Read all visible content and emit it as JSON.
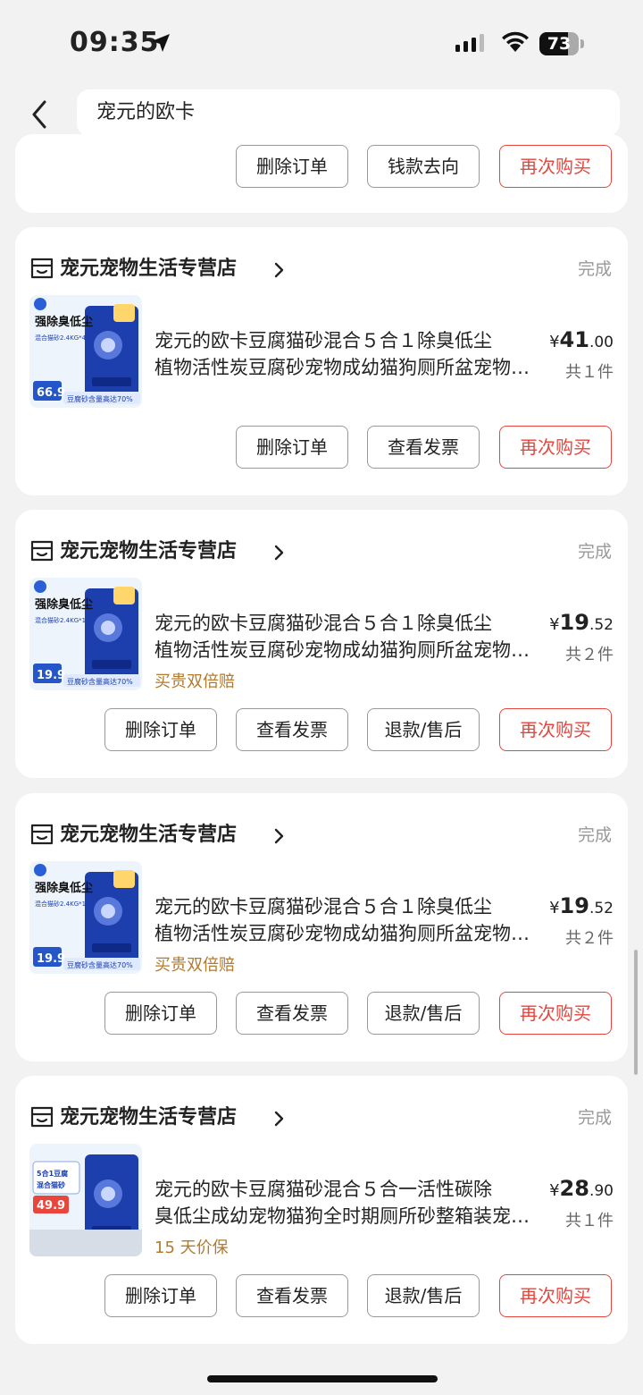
{
  "status_bar": {
    "time": "09:35",
    "battery": "73",
    "battery_level": 0.73
  },
  "header": {
    "search_text": "宠元的欧卡"
  },
  "top_card": {
    "buttons": [
      "删除订单",
      "钱款去向",
      "再次购买"
    ]
  },
  "orders": [
    {
      "shop": "宠元宠物生活专营店",
      "status": "完成",
      "title_line1": "宠元的欧卡豆腐猫砂混合５合１除臭低尘",
      "title_line2": "植物活性炭豆腐砂宠物成幼猫狗厕所盆宠物清洁用品",
      "price_int": "41",
      "price_dec": ".00",
      "currency": "¥",
      "qty": "共１件",
      "tag": "",
      "thumb": {
        "headline": "强除臭低尘",
        "spec": "混合猫砂2.4KG*4袋",
        "price": "66.9",
        "bottom": "豆腐砂含量高达70%"
      },
      "buttons": [
        "删除订单",
        "查看发票",
        "再次购买"
      ]
    },
    {
      "shop": "宠元宠物生活专营店",
      "status": "完成",
      "title_line1": "宠元的欧卡豆腐猫砂混合５合１除臭低尘",
      "title_line2": "植物活性炭豆腐砂宠物成幼猫狗厕所盆宠物清洁用品",
      "price_int": "19",
      "price_dec": ".52",
      "currency": "¥",
      "qty": "共２件",
      "tag": "买贵双倍赔",
      "thumb": {
        "headline": "强除臭低尘",
        "spec": "混合猫砂2.4KG*1袋",
        "price": "19.9",
        "bottom": "豆腐砂含量高达70%"
      },
      "buttons": [
        "删除订单",
        "查看发票",
        "退款/售后",
        "再次购买"
      ]
    },
    {
      "shop": "宠元宠物生活专营店",
      "status": "完成",
      "title_line1": "宠元的欧卡豆腐猫砂混合５合１除臭低尘",
      "title_line2": "植物活性炭豆腐砂宠物成幼猫狗厕所盆宠物清洁用品",
      "price_int": "19",
      "price_dec": ".52",
      "currency": "¥",
      "qty": "共２件",
      "tag": "买贵双倍赔",
      "thumb": {
        "headline": "强除臭低尘",
        "spec": "混合猫砂2.4KG*1袋",
        "price": "19.9",
        "bottom": "豆腐砂含量高达70%"
      },
      "buttons": [
        "删除订单",
        "查看发票",
        "退款/售后",
        "再次购买"
      ]
    },
    {
      "shop": "宠元宠物生活专营店",
      "status": "完成",
      "title_line1": "宠元的欧卡豆腐猫砂混合５合一活性碳除",
      "title_line2": "臭低尘成幼宠物猫狗全时期厕所砂整箱装宠物用品",
      "price_int": "28",
      "price_dec": ".90",
      "currency": "¥",
      "qty": "共１件",
      "tag": "15 天价保",
      "thumb": {
        "headline": "5合1豆腐混合猫砂",
        "spec": "",
        "price": "49.9",
        "bottom": ""
      },
      "buttons": [
        "删除订单",
        "查看发票",
        "退款/售后",
        "再次购买"
      ]
    }
  ]
}
